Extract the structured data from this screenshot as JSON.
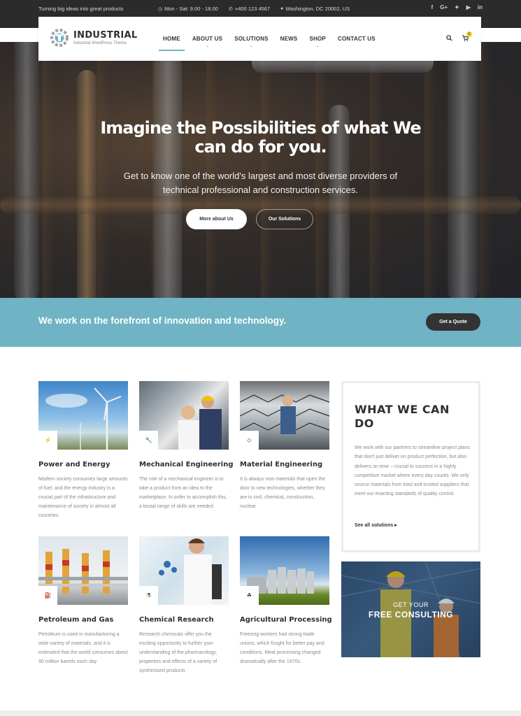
{
  "topbar": {
    "tagline": "Turning big ideas into great products",
    "hours": "Mon - Sat: 9.00 - 18.00",
    "phone": "+400 123 4567",
    "address": "Washington, DC 20002, US",
    "social": [
      "f",
      "G+",
      "twitter-icon",
      "youtube-icon",
      "in"
    ]
  },
  "header": {
    "logo_name": "INDUSTRIAL",
    "logo_sub": "Industrial WordPress Theme",
    "nav": [
      "HOME",
      "ABOUT US",
      "SOLUTIONS",
      "NEWS",
      "SHOP",
      "CONTACT US"
    ],
    "active": "HOME",
    "cart_count": "0"
  },
  "hero": {
    "title": "Imagine the Possibilities of what We can do for you.",
    "subtitle": "Get to know one of the world's largest and most diverse providers of technical professional and construction services.",
    "btn_primary": "More about Us",
    "btn_secondary": "Our Solutions"
  },
  "banner": {
    "text": "We work on the forefront of innovation and technology.",
    "button": "Get a Quote"
  },
  "services": [
    {
      "title": "Power and Energy",
      "desc": "Modern society consumes large amounts of fuel, and the energy industry is a crucial part of the infrastructure and maintenance of society in almost all countries.",
      "icon": "bolt-icon"
    },
    {
      "title": "Mechanical Engineering",
      "desc": "The role of a mechanical engineer is to take a product from an idea to the marketplace. In order to accomplish this, a broad range of skills are needed",
      "icon": "wrench-icon"
    },
    {
      "title": "Material Engineering",
      "desc": "It is always new materials that open the door to new technologies, whether they are in civil, chemical, construction, nuclear",
      "icon": "diamond-icon"
    },
    {
      "title": "Petroleum and Gas",
      "desc": "Petroleum is used in manufacturing a wide variety of materials, and it is estimated that the world consumes about 90 million barrels each day",
      "icon": "oil-icon"
    },
    {
      "title": "Chemical Research",
      "desc": "Research chemicals offer you the exciting opportunity to further your understanding of the pharmacology, properties and effects of a variety of synthesised products",
      "icon": "flask-icon"
    },
    {
      "title": "Agricultural Processing",
      "desc": "Freezing workers had strong trade unions, which fought for better pay and conditions. Meat processing changed dramatically after the 1970s.",
      "icon": "plant-icon"
    }
  ],
  "what_we_can_do": {
    "title": "WHAT WE CAN DO",
    "desc": "We work with our partners to streamline project plans that don't just deliver on product perfection, but also delivers on time – crucial to success in a highly competitive market where every day counts. We only source materials from tried and trusted suppliers that meet our exacting standards of quality control.",
    "link": "See all solutions ▸"
  },
  "consulting": {
    "line1": "GET YOUR",
    "line2": "FREE CONSULTING"
  },
  "colors": {
    "accent": "#6fb3c4",
    "dark": "#2b2b2b",
    "cart_badge": "#f3d11d"
  }
}
